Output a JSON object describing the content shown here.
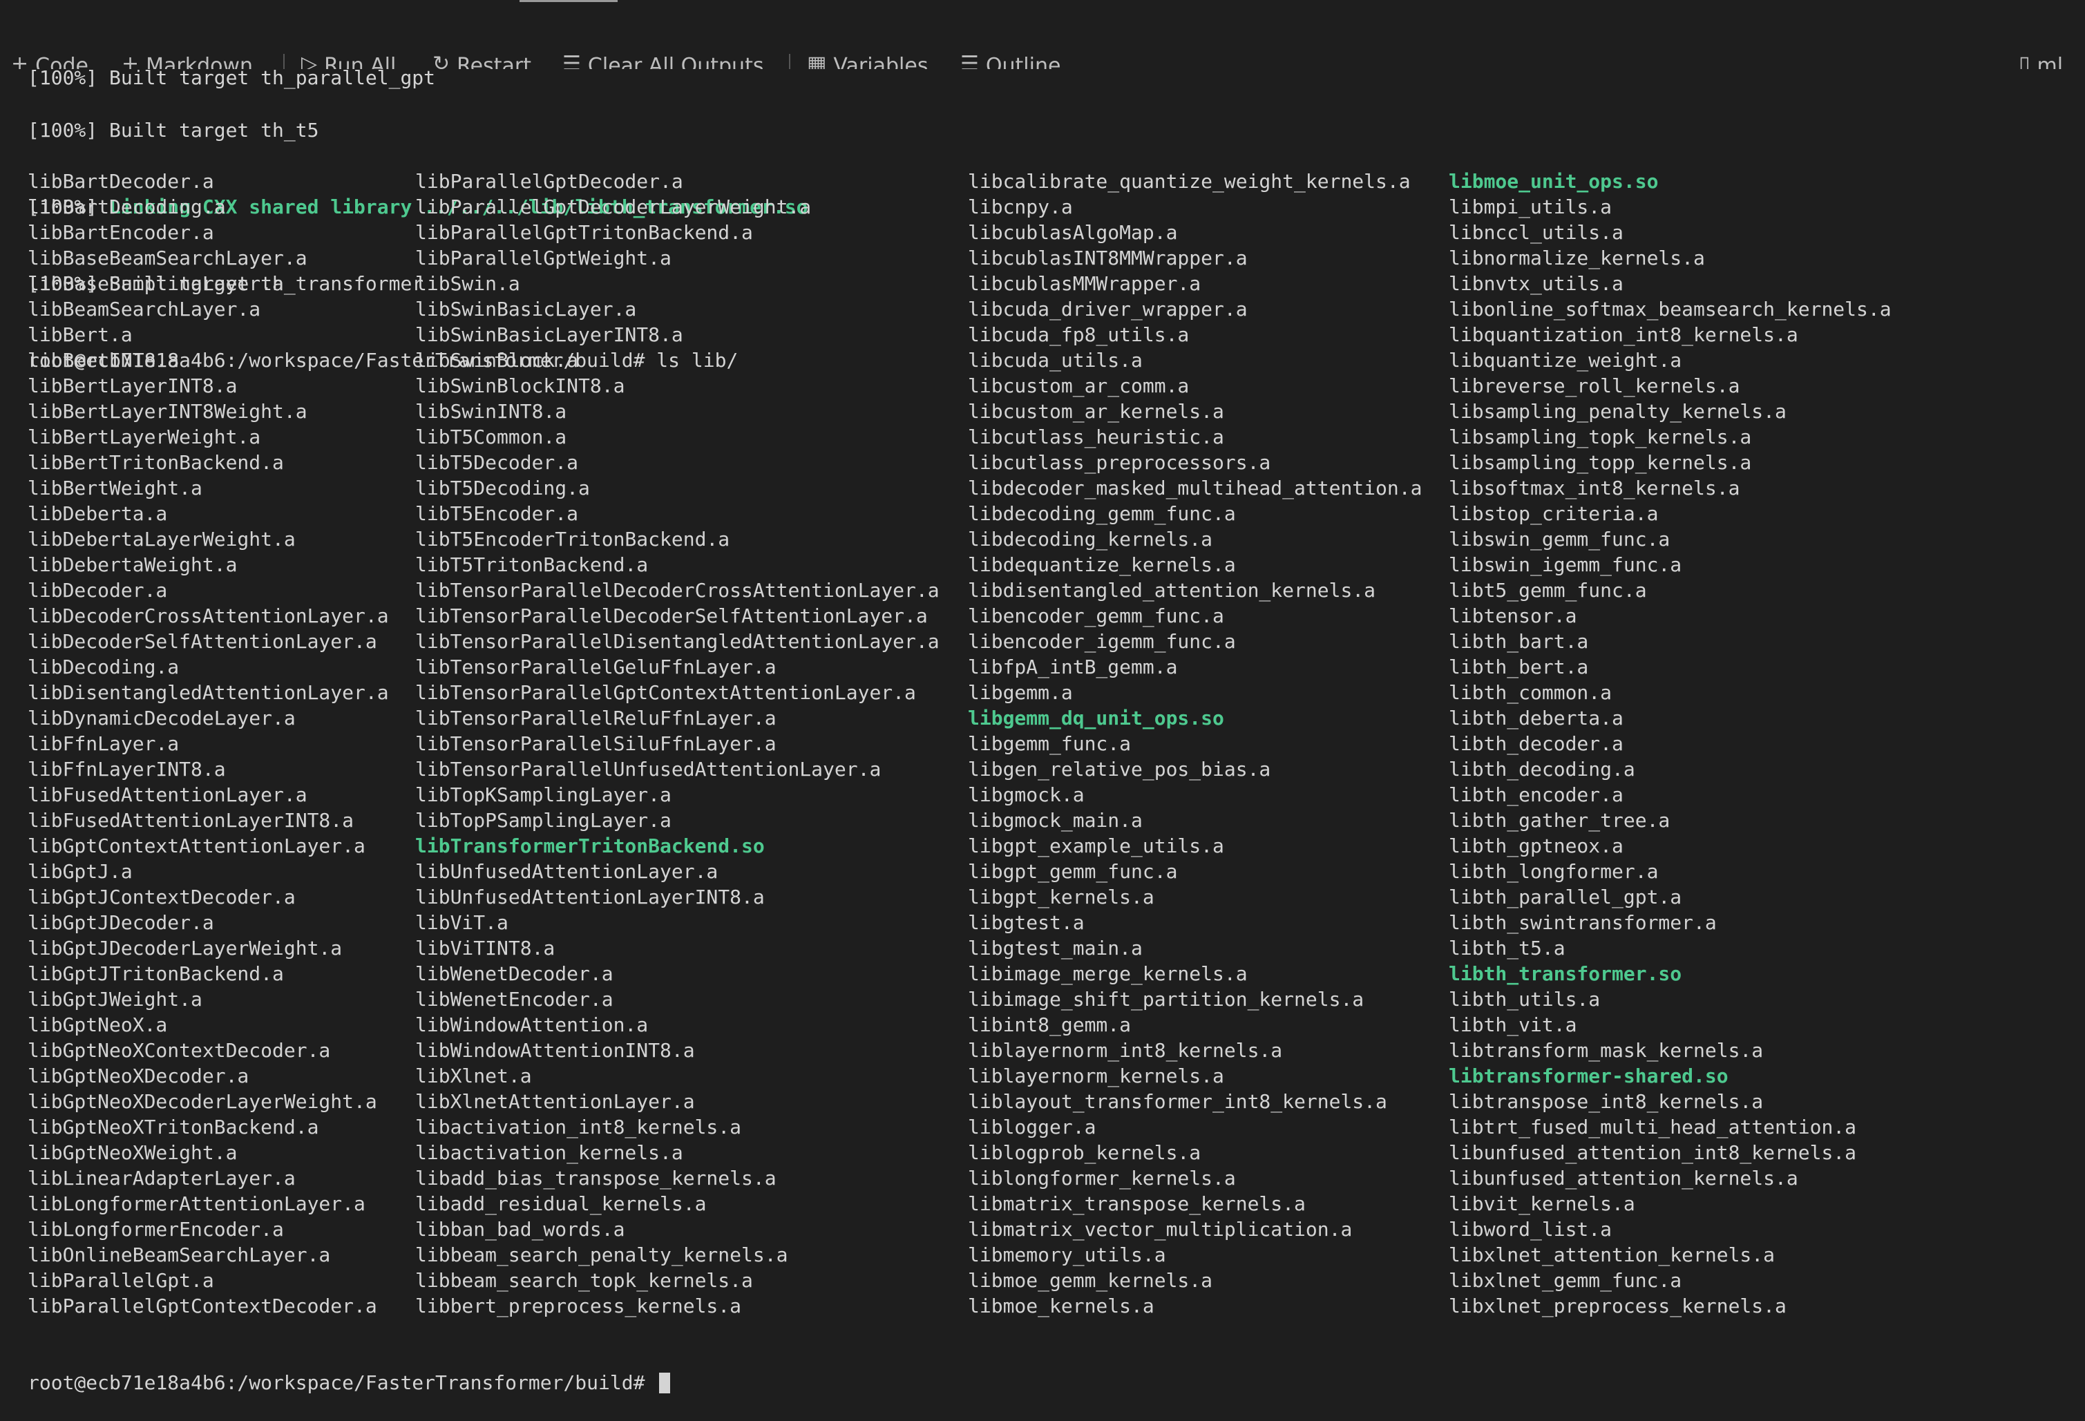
{
  "top_line": "[100%] Built target th_parallel_gpt",
  "toolbar": {
    "code": "Code",
    "markdown": "Markdown",
    "run_all": "Run All",
    "restart": "Restart",
    "clear_all": "Clear All Outputs",
    "variables": "Variables",
    "outline": "Outline",
    "more": "...",
    "right": "ml"
  },
  "header_lines": {
    "built_t5": "[100%] Built target th_t5",
    "linking_prefix": "[100%] ",
    "linking": "Linking CXX shared library ../../../lib/libth_transformer.so",
    "built_transformer": "[100%] Built target th_transformer",
    "ls_cmd": "root@ecb71e18a4b6:/workspace/FasterTransformer/build# ls lib/"
  },
  "prompt": "root@ecb71e18a4b6:/workspace/FasterTransformer/build# ",
  "columns": [
    [
      {
        "text": "libBartDecoder.a"
      },
      {
        "text": "libBartDecoding.a"
      },
      {
        "text": "libBartEncoder.a"
      },
      {
        "text": "libBaseBeamSearchLayer.a"
      },
      {
        "text": "libBaseSamplingLayer.a"
      },
      {
        "text": "libBeamSearchLayer.a"
      },
      {
        "text": "libBert.a"
      },
      {
        "text": "libBertINT8.a"
      },
      {
        "text": "libBertLayerINT8.a"
      },
      {
        "text": "libBertLayerINT8Weight.a"
      },
      {
        "text": "libBertLayerWeight.a"
      },
      {
        "text": "libBertTritonBackend.a"
      },
      {
        "text": "libBertWeight.a"
      },
      {
        "text": "libDeberta.a"
      },
      {
        "text": "libDebertaLayerWeight.a"
      },
      {
        "text": "libDebertaWeight.a"
      },
      {
        "text": "libDecoder.a"
      },
      {
        "text": "libDecoderCrossAttentionLayer.a"
      },
      {
        "text": "libDecoderSelfAttentionLayer.a"
      },
      {
        "text": "libDecoding.a"
      },
      {
        "text": "libDisentangledAttentionLayer.a"
      },
      {
        "text": "libDynamicDecodeLayer.a"
      },
      {
        "text": "libFfnLayer.a"
      },
      {
        "text": "libFfnLayerINT8.a"
      },
      {
        "text": "libFusedAttentionLayer.a"
      },
      {
        "text": "libFusedAttentionLayerINT8.a"
      },
      {
        "text": "libGptContextAttentionLayer.a"
      },
      {
        "text": "libGptJ.a"
      },
      {
        "text": "libGptJContextDecoder.a"
      },
      {
        "text": "libGptJDecoder.a"
      },
      {
        "text": "libGptJDecoderLayerWeight.a"
      },
      {
        "text": "libGptJTritonBackend.a"
      },
      {
        "text": "libGptJWeight.a"
      },
      {
        "text": "libGptNeoX.a"
      },
      {
        "text": "libGptNeoXContextDecoder.a"
      },
      {
        "text": "libGptNeoXDecoder.a"
      },
      {
        "text": "libGptNeoXDecoderLayerWeight.a"
      },
      {
        "text": "libGptNeoXTritonBackend.a"
      },
      {
        "text": "libGptNeoXWeight.a"
      },
      {
        "text": "libLinearAdapterLayer.a"
      },
      {
        "text": "libLongformerAttentionLayer.a"
      },
      {
        "text": "libLongformerEncoder.a"
      },
      {
        "text": "libOnlineBeamSearchLayer.a"
      },
      {
        "text": "libParallelGpt.a"
      },
      {
        "text": "libParallelGptContextDecoder.a"
      }
    ],
    [
      {
        "text": "libParallelGptDecoder.a"
      },
      {
        "text": "libParallelGptDecoderLayerWeight.a"
      },
      {
        "text": "libParallelGptTritonBackend.a"
      },
      {
        "text": "libParallelGptWeight.a"
      },
      {
        "text": "libSwin.a"
      },
      {
        "text": "libSwinBasicLayer.a"
      },
      {
        "text": "libSwinBasicLayerINT8.a"
      },
      {
        "text": "libSwinBlock.a"
      },
      {
        "text": "libSwinBlockINT8.a"
      },
      {
        "text": "libSwinINT8.a"
      },
      {
        "text": "libT5Common.a"
      },
      {
        "text": "libT5Decoder.a"
      },
      {
        "text": "libT5Decoding.a"
      },
      {
        "text": "libT5Encoder.a"
      },
      {
        "text": "libT5EncoderTritonBackend.a"
      },
      {
        "text": "libT5TritonBackend.a"
      },
      {
        "text": "libTensorParallelDecoderCrossAttentionLayer.a"
      },
      {
        "text": "libTensorParallelDecoderSelfAttentionLayer.a"
      },
      {
        "text": "libTensorParallelDisentangledAttentionLayer.a"
      },
      {
        "text": "libTensorParallelGeluFfnLayer.a"
      },
      {
        "text": "libTensorParallelGptContextAttentionLayer.a"
      },
      {
        "text": "libTensorParallelReluFfnLayer.a"
      },
      {
        "text": "libTensorParallelSiluFfnLayer.a"
      },
      {
        "text": "libTensorParallelUnfusedAttentionLayer.a"
      },
      {
        "text": "libTopKSamplingLayer.a"
      },
      {
        "text": "libTopPSamplingLayer.a"
      },
      {
        "text": "libTransformerTritonBackend.so",
        "green": true
      },
      {
        "text": "libUnfusedAttentionLayer.a"
      },
      {
        "text": "libUnfusedAttentionLayerINT8.a"
      },
      {
        "text": "libViT.a"
      },
      {
        "text": "libViTINT8.a"
      },
      {
        "text": "libWenetDecoder.a"
      },
      {
        "text": "libWenetEncoder.a"
      },
      {
        "text": "libWindowAttention.a"
      },
      {
        "text": "libWindowAttentionINT8.a"
      },
      {
        "text": "libXlnet.a"
      },
      {
        "text": "libXlnetAttentionLayer.a"
      },
      {
        "text": "libactivation_int8_kernels.a"
      },
      {
        "text": "libactivation_kernels.a"
      },
      {
        "text": "libadd_bias_transpose_kernels.a"
      },
      {
        "text": "libadd_residual_kernels.a"
      },
      {
        "text": "libban_bad_words.a"
      },
      {
        "text": "libbeam_search_penalty_kernels.a"
      },
      {
        "text": "libbeam_search_topk_kernels.a"
      },
      {
        "text": "libbert_preprocess_kernels.a"
      }
    ],
    [
      {
        "text": "libcalibrate_quantize_weight_kernels.a"
      },
      {
        "text": "libcnpy.a"
      },
      {
        "text": "libcublasAlgoMap.a"
      },
      {
        "text": "libcublasINT8MMWrapper.a"
      },
      {
        "text": "libcublasMMWrapper.a"
      },
      {
        "text": "libcuda_driver_wrapper.a"
      },
      {
        "text": "libcuda_fp8_utils.a"
      },
      {
        "text": "libcuda_utils.a"
      },
      {
        "text": "libcustom_ar_comm.a"
      },
      {
        "text": "libcustom_ar_kernels.a"
      },
      {
        "text": "libcutlass_heuristic.a"
      },
      {
        "text": "libcutlass_preprocessors.a"
      },
      {
        "text": "libdecoder_masked_multihead_attention.a"
      },
      {
        "text": "libdecoding_gemm_func.a"
      },
      {
        "text": "libdecoding_kernels.a"
      },
      {
        "text": "libdequantize_kernels.a"
      },
      {
        "text": "libdisentangled_attention_kernels.a"
      },
      {
        "text": "libencoder_gemm_func.a"
      },
      {
        "text": "libencoder_igemm_func.a"
      },
      {
        "text": "libfpA_intB_gemm.a"
      },
      {
        "text": "libgemm.a"
      },
      {
        "text": "libgemm_dq_unit_ops.so",
        "green": true
      },
      {
        "text": "libgemm_func.a"
      },
      {
        "text": "libgen_relative_pos_bias.a"
      },
      {
        "text": "libgmock.a"
      },
      {
        "text": "libgmock_main.a"
      },
      {
        "text": "libgpt_example_utils.a"
      },
      {
        "text": "libgpt_gemm_func.a"
      },
      {
        "text": "libgpt_kernels.a"
      },
      {
        "text": "libgtest.a"
      },
      {
        "text": "libgtest_main.a"
      },
      {
        "text": "libimage_merge_kernels.a"
      },
      {
        "text": "libimage_shift_partition_kernels.a"
      },
      {
        "text": "libint8_gemm.a"
      },
      {
        "text": "liblayernorm_int8_kernels.a"
      },
      {
        "text": "liblayernorm_kernels.a"
      },
      {
        "text": "liblayout_transformer_int8_kernels.a"
      },
      {
        "text": "liblogger.a"
      },
      {
        "text": "liblogprob_kernels.a"
      },
      {
        "text": "liblongformer_kernels.a"
      },
      {
        "text": "libmatrix_transpose_kernels.a"
      },
      {
        "text": "libmatrix_vector_multiplication.a"
      },
      {
        "text": "libmemory_utils.a"
      },
      {
        "text": "libmoe_gemm_kernels.a"
      },
      {
        "text": "libmoe_kernels.a"
      }
    ],
    [
      {
        "text": "libmoe_unit_ops.so",
        "green": true
      },
      {
        "text": "libmpi_utils.a"
      },
      {
        "text": "libnccl_utils.a"
      },
      {
        "text": "libnormalize_kernels.a"
      },
      {
        "text": "libnvtx_utils.a"
      },
      {
        "text": "libonline_softmax_beamsearch_kernels.a"
      },
      {
        "text": "libquantization_int8_kernels.a"
      },
      {
        "text": "libquantize_weight.a"
      },
      {
        "text": "libreverse_roll_kernels.a"
      },
      {
        "text": "libsampling_penalty_kernels.a"
      },
      {
        "text": "libsampling_topk_kernels.a"
      },
      {
        "text": "libsampling_topp_kernels.a"
      },
      {
        "text": "libsoftmax_int8_kernels.a"
      },
      {
        "text": "libstop_criteria.a"
      },
      {
        "text": "libswin_gemm_func.a"
      },
      {
        "text": "libswin_igemm_func.a"
      },
      {
        "text": "libt5_gemm_func.a"
      },
      {
        "text": "libtensor.a"
      },
      {
        "text": "libth_bart.a"
      },
      {
        "text": "libth_bert.a"
      },
      {
        "text": "libth_common.a"
      },
      {
        "text": "libth_deberta.a"
      },
      {
        "text": "libth_decoder.a"
      },
      {
        "text": "libth_decoding.a"
      },
      {
        "text": "libth_encoder.a"
      },
      {
        "text": "libth_gather_tree.a"
      },
      {
        "text": "libth_gptneox.a"
      },
      {
        "text": "libth_longformer.a"
      },
      {
        "text": "libth_parallel_gpt.a"
      },
      {
        "text": "libth_swintransformer.a"
      },
      {
        "text": "libth_t5.a"
      },
      {
        "text": "libth_transformer.so",
        "green": true
      },
      {
        "text": "libth_utils.a"
      },
      {
        "text": "libth_vit.a"
      },
      {
        "text": "libtransform_mask_kernels.a"
      },
      {
        "text": "libtransformer-shared.so",
        "green": true
      },
      {
        "text": "libtranspose_int8_kernels.a"
      },
      {
        "text": "libtrt_fused_multi_head_attention.a"
      },
      {
        "text": "libunfused_attention_int8_kernels.a"
      },
      {
        "text": "libunfused_attention_kernels.a"
      },
      {
        "text": "libvit_kernels.a"
      },
      {
        "text": "libword_list.a"
      },
      {
        "text": "libxlnet_attention_kernels.a"
      },
      {
        "text": "libxlnet_gemm_func.a"
      },
      {
        "text": "libxlnet_preprocess_kernels.a"
      }
    ]
  ],
  "colors": {
    "background": "#1e1e1e",
    "text": "#d4d4d4",
    "green": "#4ec98f"
  }
}
